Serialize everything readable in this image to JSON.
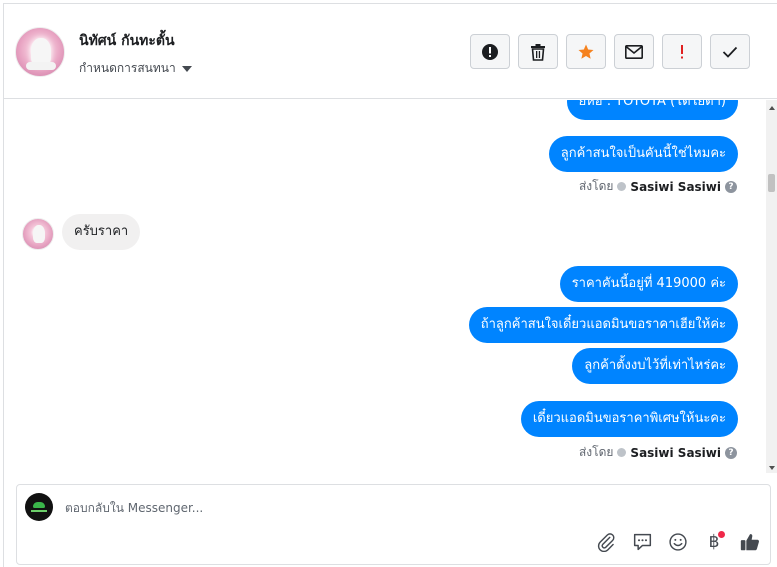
{
  "header": {
    "contact_name": "นิทัศน์ กันทะตั้น",
    "conversation_setting": "กำหนดการสนทนา",
    "actions": [
      {
        "name": "report-button",
        "icon": "alert-circle-icon"
      },
      {
        "name": "delete-button",
        "icon": "trash-icon"
      },
      {
        "name": "star-button",
        "icon": "star-icon"
      },
      {
        "name": "mark-unread-button",
        "icon": "envelope-icon"
      },
      {
        "name": "important-button",
        "icon": "exclamation-icon"
      },
      {
        "name": "mark-done-button",
        "icon": "checkmark-icon"
      }
    ]
  },
  "messages": {
    "cut_off_text": "ยี่ห้อ : TOYOTA (โตโยต้า)",
    "m1": "ลูกค้าสนใจเป็นคันนี้ใช่ไหมคะ",
    "sent_by_1": {
      "prefix": "ส่งโดย",
      "agent": "Sasiwi Sasiwi"
    },
    "incoming": "ครับราคา",
    "m2": "ราคาคันนี้อยู่ที่ 419000 ค่ะ",
    "m3": "ถ้าลูกค้าสนใจเดี๋ยวแอดมินขอราคาเฮียให้ค่ะ",
    "m4": "ลูกค้าตั้งงบไว้ที่เท่าไหร่คะ",
    "m5": "เดี๋ยวแอดมินขอราคาพิเศษให้นะคะ",
    "sent_by_2": {
      "prefix": "ส่งโดย",
      "agent": "Sasiwi Sasiwi"
    }
  },
  "composer": {
    "placeholder": "ตอบกลับใน Messenger...",
    "tools": [
      "paperclip-icon",
      "speech-bubble-icon",
      "smiley-icon",
      "baht-icon",
      "thumbs-up-icon"
    ],
    "baht_symbol": "฿"
  },
  "colors": {
    "outgoing_bubble": "#0084ff",
    "incoming_bubble": "#f1f0f0",
    "star": "#f5821f",
    "important": "#e02020",
    "notification_dot": "#f02849"
  }
}
